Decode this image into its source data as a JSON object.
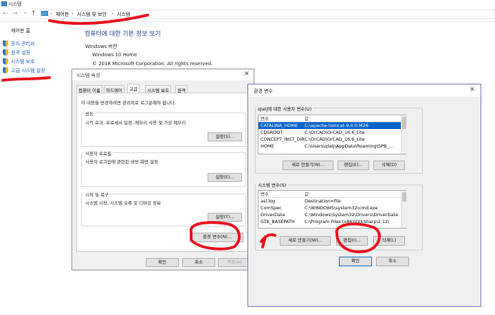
{
  "system_window": {
    "title": "시스템",
    "nav": {
      "back": "←",
      "forward": "→",
      "down": "⌄",
      "up": "↑"
    },
    "breadcrumbs": [
      "제어판",
      "시스템 및 보안",
      "시스템"
    ],
    "crumb_sep": "›",
    "left_nav": {
      "home": "제어판 홈",
      "items": [
        "장치 관리자",
        "원격 설정",
        "시스템 보호",
        "고급 시스템 설정"
      ]
    },
    "heading": "컴퓨터에 대한 기본 정보 보기",
    "windows_edition_label": "Windows 버전",
    "windows_name": "Windows 10 Home",
    "copyright": "© 2018 Microsoft Corporation. All rights reserved."
  },
  "sysprops": {
    "title": "시스템 속성",
    "close": "✕",
    "tabs": [
      "컴퓨터 이름",
      "하드웨어",
      "고급",
      "시스템 보호",
      "원격"
    ],
    "active_tab": "고급",
    "admin_note": "이 내용을 변경하려면 관리자로 로그온해야 합니다.",
    "performance": {
      "label": "성능",
      "desc": "시각 효과, 프로세서 일정, 메모리 사용 및 가상 메모리",
      "button": "설정(S)..."
    },
    "user_profiles": {
      "label": "사용자 프로필",
      "desc": "사용자 로그인에 관련된 바탕 화면 설정",
      "button": "설정(E)..."
    },
    "startup": {
      "label": "시작 및 복구",
      "desc": "시스템 시작, 시스템 오류 및 디버깅 정보",
      "button": "설정(T)..."
    },
    "env_button": "환경 변수(N)...",
    "ok": "확인",
    "cancel": "취소",
    "apply": "적용(A)"
  },
  "envvars": {
    "title": "환경 변수",
    "close": "✕",
    "user_group_label": "qlatj에 대한 사용자 변수(U)",
    "col_var": "변수",
    "col_val": "값",
    "user_vars": [
      {
        "name": "CATALINA_HOME",
        "value": "C:\\apache-tomcat-9.0.0.M26",
        "selected": true
      },
      {
        "name": "CDSROOT",
        "value": "C:\\OrCAD\\OrCAD_16.6_Lite",
        "selected": false
      },
      {
        "name": "CONCEPT_INST_DIR",
        "value": "C:\\OrCAD\\OrCAD_16.6_Lite",
        "selected": false
      },
      {
        "name": "HOME",
        "value": "C:\\Users\\qlatj\\AppData\\Roaming\\SPB_...",
        "selected": false
      }
    ],
    "user_buttons": {
      "new": "새로 만들기(N)...",
      "edit": "편집(E)...",
      "delete": "삭제(D)"
    },
    "system_group_label": "시스템 변수(S)",
    "system_vars": [
      {
        "name": "asl.log",
        "value": "Destination=file"
      },
      {
        "name": "ComSpec",
        "value": "C:\\WINDOWS\\system32\\cmd.exe"
      },
      {
        "name": "DriverData",
        "value": "C:\\Windows\\System32\\Drivers\\DriverData"
      },
      {
        "name": "GTK_BASEPATH",
        "value": "C:\\Program Files (x86)\\GtkSharp\\2.12\\"
      }
    ],
    "system_buttons": {
      "new": "새로 만들기(W)...",
      "edit": "편집(I)...",
      "delete": "삭제(L)"
    },
    "ok": "확인",
    "cancel": "취소"
  },
  "colors": {
    "annotation_red": "#e8101a",
    "selection_blue": "#0a64c8",
    "link_blue": "#1a5fb4"
  }
}
